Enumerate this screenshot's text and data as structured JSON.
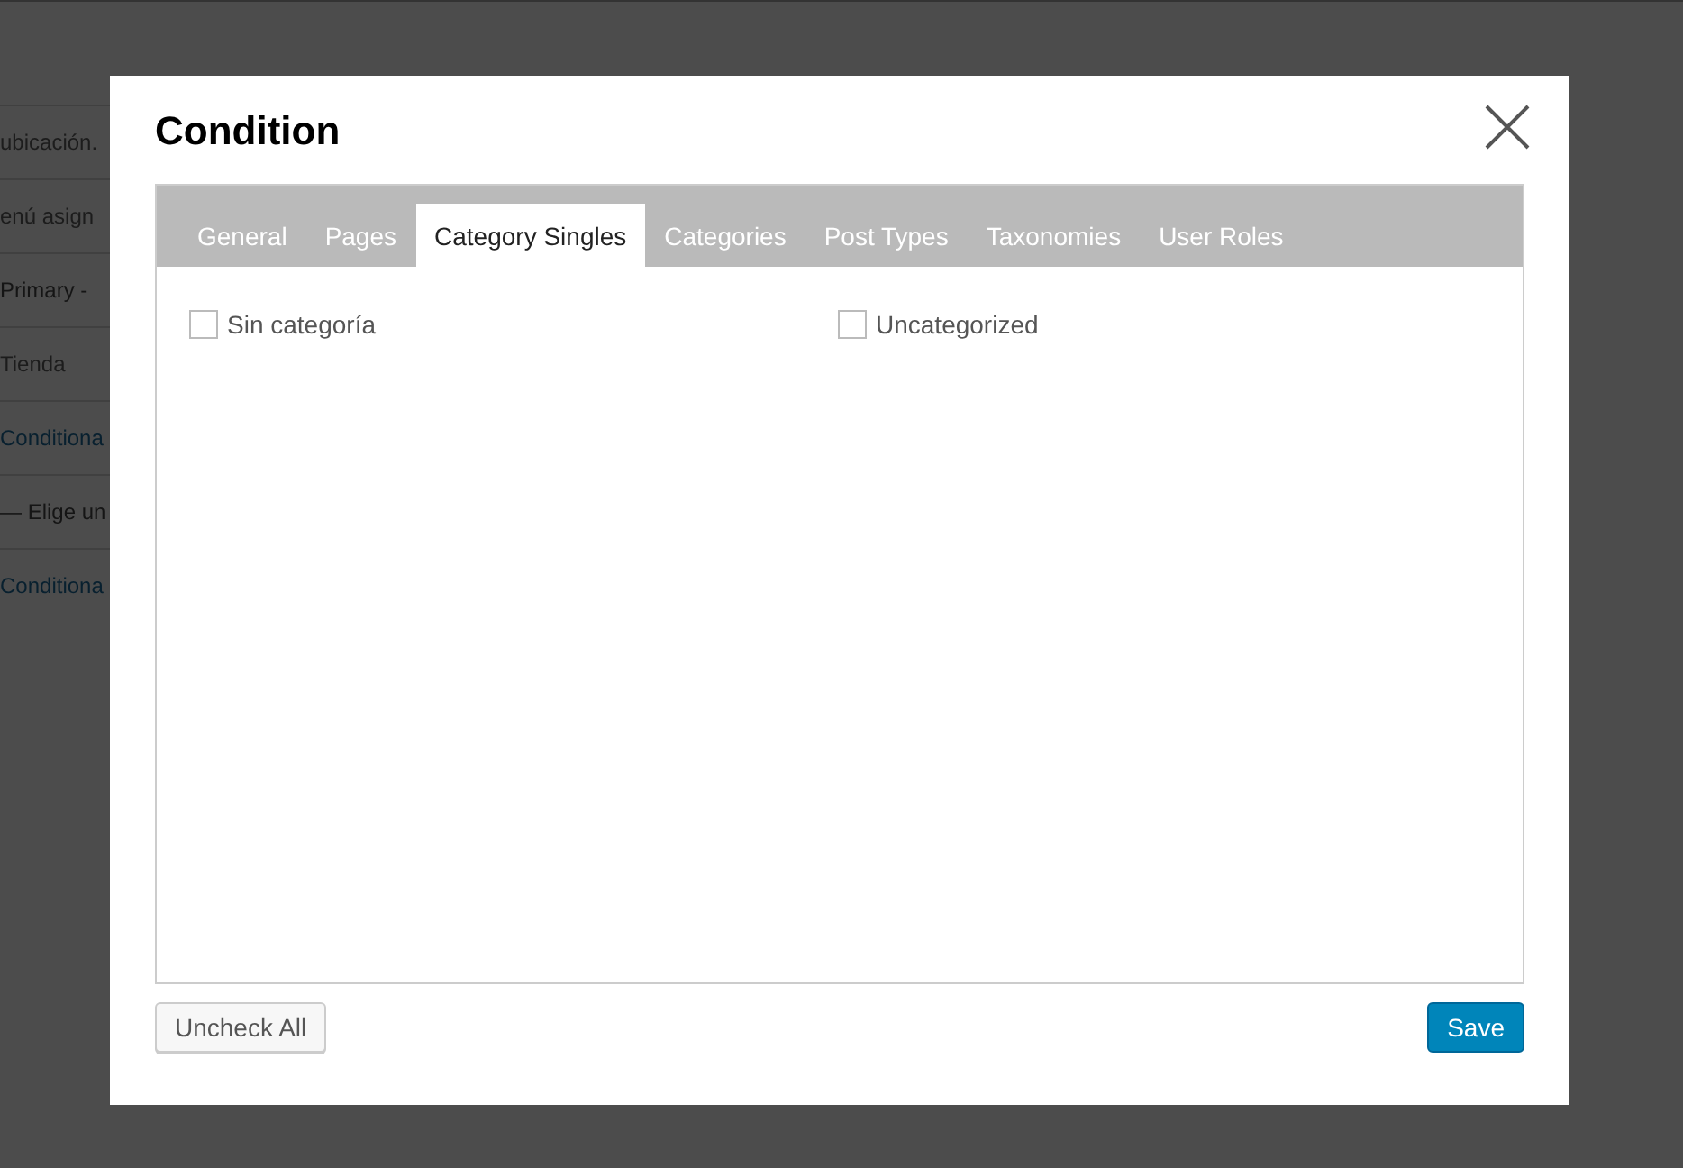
{
  "background_page": {
    "rows": [
      {
        "text": "ubicación.",
        "kind": "text"
      },
      {
        "text": "enú asign",
        "kind": "text"
      },
      {
        "text": "Primary - ",
        "kind": "select"
      },
      {
        "text": "Tienda",
        "kind": "text"
      },
      {
        "text": "Conditiona",
        "kind": "link"
      },
      {
        "text": "— Elige un",
        "kind": "select"
      },
      {
        "text": "Conditiona",
        "kind": "link"
      }
    ]
  },
  "dialog": {
    "title": "Condition",
    "tabs": [
      {
        "label": "General",
        "selected": false
      },
      {
        "label": "Pages",
        "selected": false
      },
      {
        "label": "Category Singles",
        "selected": true
      },
      {
        "label": "Categories",
        "selected": false
      },
      {
        "label": "Post Types",
        "selected": false
      },
      {
        "label": "Taxonomies",
        "selected": false
      },
      {
        "label": "User Roles",
        "selected": false
      }
    ],
    "options": [
      {
        "label": "Sin categoría",
        "checked": false
      },
      {
        "label": "Uncategorized",
        "checked": false
      }
    ],
    "buttons": {
      "uncheck_all": "Uncheck All",
      "save": "Save"
    }
  }
}
